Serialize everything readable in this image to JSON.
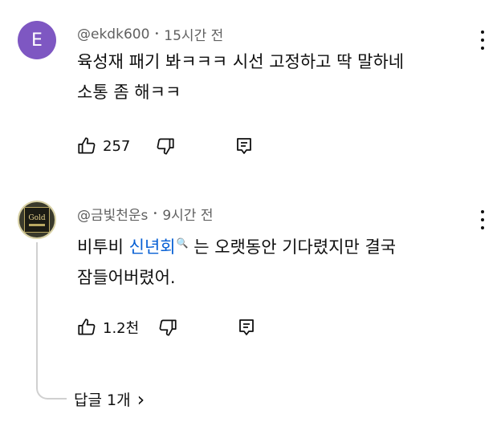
{
  "comments": [
    {
      "avatar_letter": "E",
      "avatar_color": "#7e57c2",
      "author": "@ekdk600",
      "time": "15시간 전",
      "lines": [
        "육성재 패기 봐ㅋㅋㅋ 시선 고정하고 딱 말하네",
        "소통 좀 해ㅋㅋ"
      ],
      "likes": "257"
    },
    {
      "avatar_text": "Gold",
      "author": "@금빛천운s",
      "time": "9시간 전",
      "text_before": "비투비 ",
      "link_text": "신년회",
      "link_icon": "🔍",
      "text_after": " 는 오랫동안 기다렸지만 결국",
      "line2": "잠들어버렸어.",
      "likes": "1.2천",
      "replies_label": "답글 1개",
      "replies_chevron": "›"
    }
  ],
  "meta_separator": "•",
  "colors": {
    "link": "#065fd4",
    "secondary_text": "#606060",
    "primary_text": "#0f0f0f"
  }
}
